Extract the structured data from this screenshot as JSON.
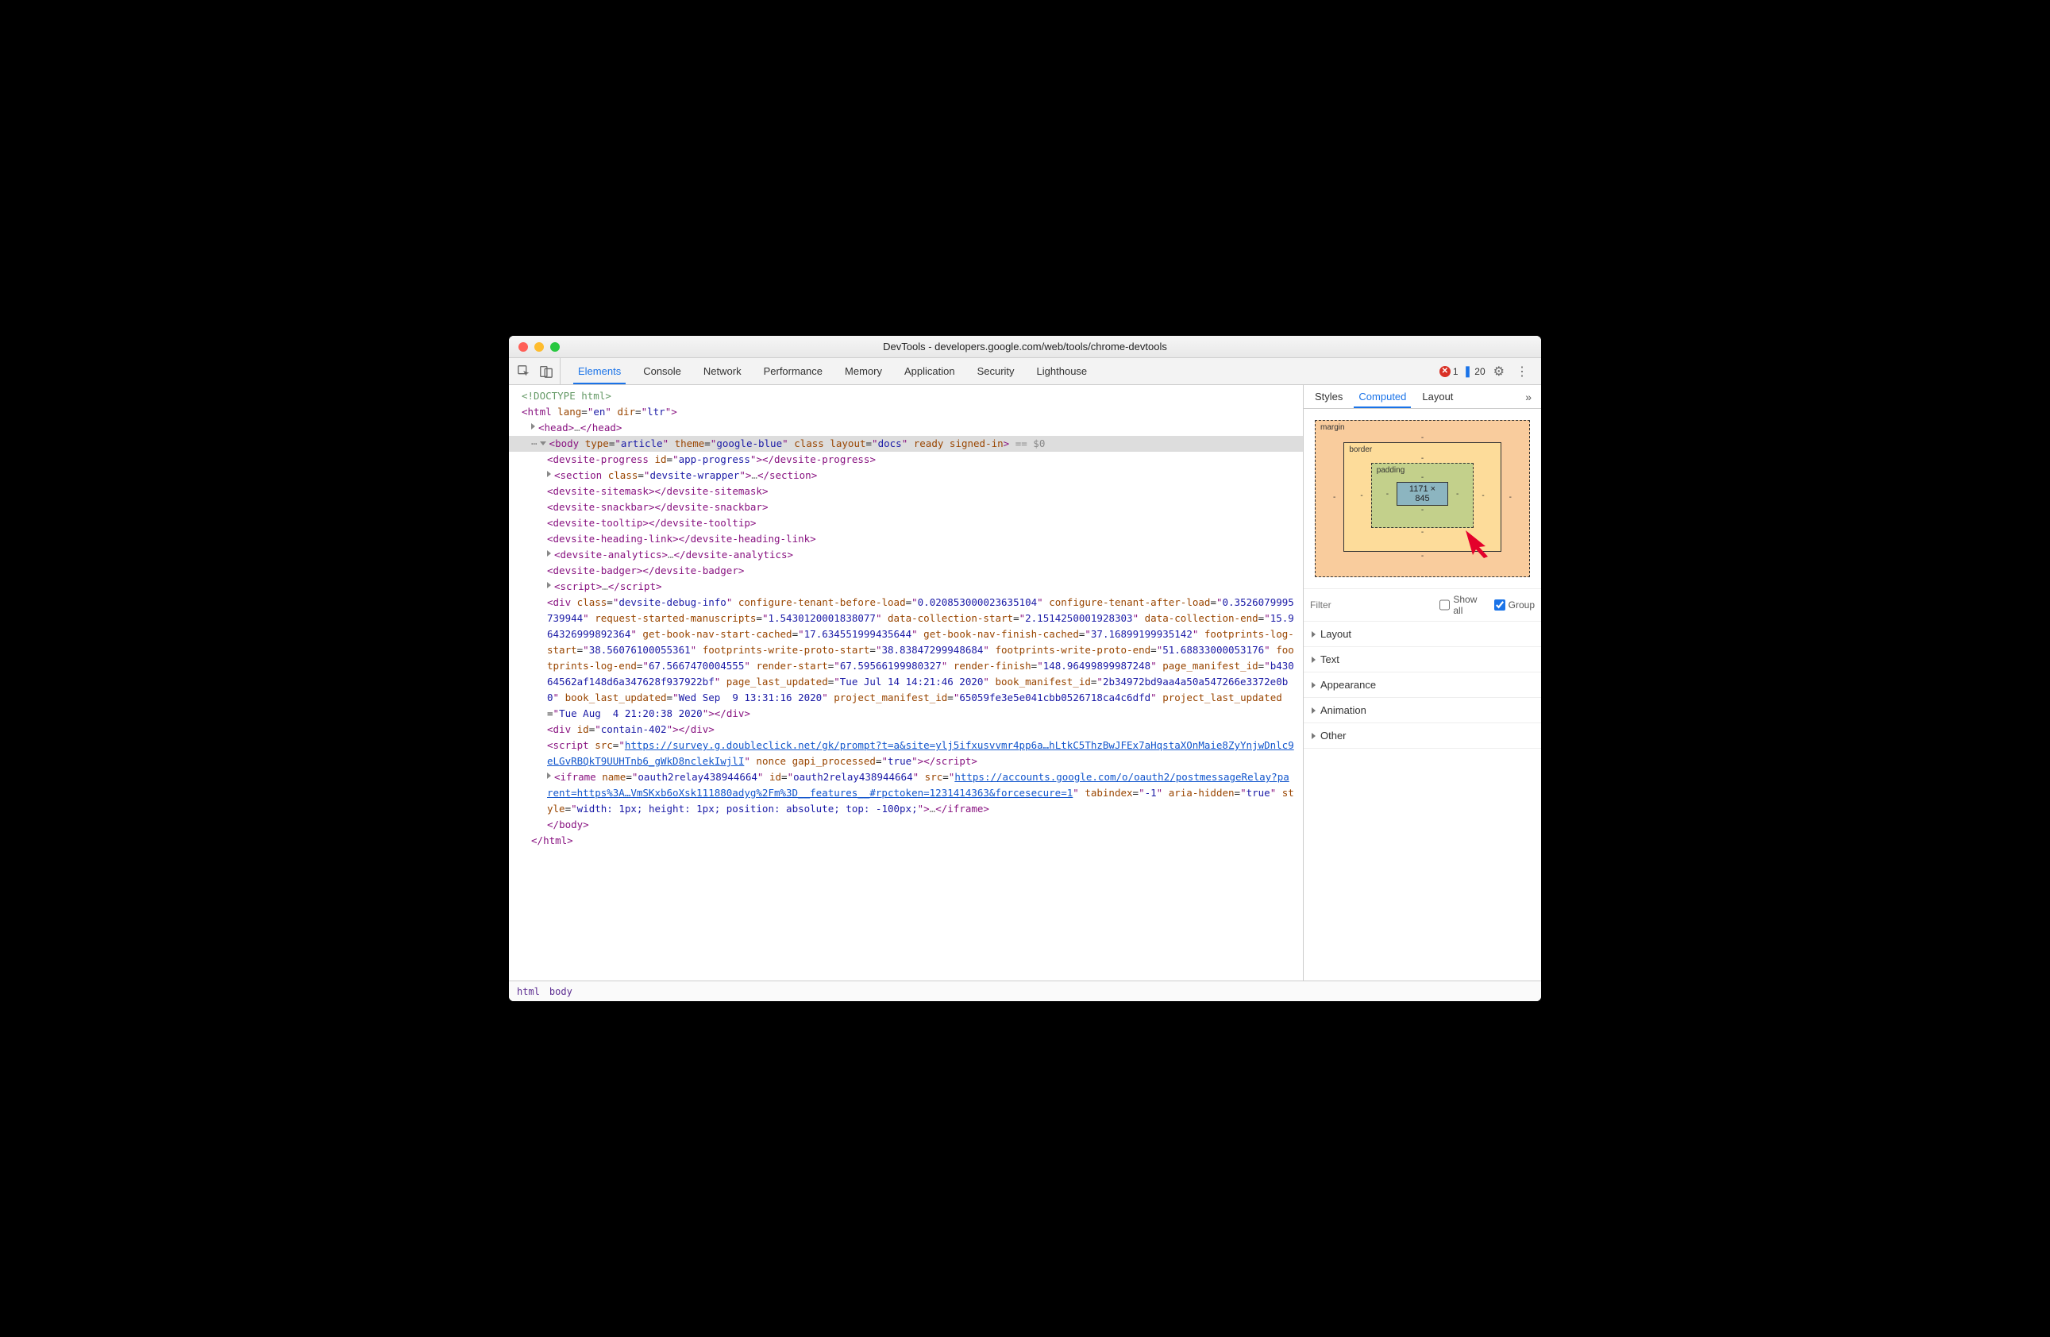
{
  "window": {
    "title": "DevTools - developers.google.com/web/tools/chrome-devtools"
  },
  "tabs": [
    "Elements",
    "Console",
    "Network",
    "Performance",
    "Memory",
    "Application",
    "Security",
    "Lighthouse"
  ],
  "activeTab": "Elements",
  "counters": {
    "errors": "1",
    "messages": "20"
  },
  "breadcrumb": [
    "html",
    "body"
  ],
  "sidebar": {
    "tabs": [
      "Styles",
      "Computed",
      "Layout"
    ],
    "active": "Computed",
    "moreGlyph": "»"
  },
  "boxmodel": {
    "margin": "margin",
    "border": "border",
    "padding": "padding",
    "dash": "-",
    "content": "1171 × 845"
  },
  "filter": {
    "placeholder": "Filter",
    "showall": "Show all",
    "group": "Group"
  },
  "groups": [
    "Layout",
    "Text",
    "Appearance",
    "Animation",
    "Other"
  ],
  "dom": {
    "doctype": "<!DOCTYPE html>",
    "html_open": "<html lang=\"en\" dir=\"ltr\">",
    "head": {
      "open": "<head>",
      "close": "</head>",
      "mid": "…"
    },
    "body_open_tag": "body",
    "body_attrs": [
      {
        "n": "type",
        "v": "article"
      },
      {
        "n": "theme",
        "v": "google-blue"
      },
      {
        "n": "class",
        "v": null
      },
      {
        "n": "layout",
        "v": "docs"
      },
      {
        "n": "ready",
        "v": null
      },
      {
        "n": "signed-in",
        "v": null
      }
    ],
    "body_suffix": " == $0",
    "children": [
      {
        "raw": "<devsite-progress id=\"app-progress\"></devsite-progress>",
        "attrs": [
          {
            "n": "id",
            "v": "app-progress"
          }
        ],
        "tag": "devsite-progress"
      },
      {
        "tag": "section",
        "attrs": [
          {
            "n": "class",
            "v": "devsite-wrapper"
          }
        ],
        "expand": true,
        "mid": "…"
      },
      {
        "tag": "devsite-sitemask",
        "selfclose": true
      },
      {
        "tag": "devsite-snackbar",
        "selfclose": true
      },
      {
        "tag": "devsite-tooltip",
        "selfclose": true
      },
      {
        "tag": "devsite-heading-link",
        "selfclose": true
      },
      {
        "tag": "devsite-analytics",
        "expand": true,
        "mid": "…"
      },
      {
        "tag": "devsite-badger",
        "selfclose": true
      },
      {
        "tag": "script",
        "expand": true,
        "mid": "…"
      }
    ],
    "bigdiv": {
      "tag": "div",
      "attrs": [
        {
          "n": "class",
          "v": "devsite-debug-info"
        },
        {
          "n": "configure-tenant-before-load",
          "v": "0.020853000023635104"
        },
        {
          "n": "configure-tenant-after-load",
          "v": "0.3526079995739944"
        },
        {
          "n": "request-started-manuscripts",
          "v": "1.5430120001838077"
        },
        {
          "n": "data-collection-start",
          "v": "2.1514250001928303"
        },
        {
          "n": "data-collection-end",
          "v": "15.964326999892364"
        },
        {
          "n": "get-book-nav-start-cached",
          "v": "17.634551999435644"
        },
        {
          "n": "get-book-nav-finish-cached",
          "v": "37.16899199935142"
        },
        {
          "n": "footprints-log-start",
          "v": "38.56076100055361"
        },
        {
          "n": "footprints-write-proto-start",
          "v": "38.83847299948684"
        },
        {
          "n": "footprints-write-proto-end",
          "v": "51.68833000053176"
        },
        {
          "n": "footprints-log-end",
          "v": "67.5667470004555"
        },
        {
          "n": "render-start",
          "v": "67.59566199980327"
        },
        {
          "n": "render-finish",
          "v": "148.96499899987248"
        },
        {
          "n": "page_manifest_id",
          "v": "b43064562af148d6a347628f937922bf"
        },
        {
          "n": "page_last_updated",
          "v": "Tue Jul 14 14:21:46 2020"
        },
        {
          "n": "book_manifest_id",
          "v": "2b34972bd9aa4a50a547266e3372e0b0"
        },
        {
          "n": "book_last_updated",
          "v": "Wed Sep  9 13:31:16 2020"
        },
        {
          "n": "project_manifest_id",
          "v": "65059fe3e5e041cbb0526718ca4c6dfd"
        },
        {
          "n": "project_last_updated",
          "v": "Tue Aug  4 21:20:38 2020"
        }
      ]
    },
    "contain": {
      "tag": "div",
      "attrs": [
        {
          "n": "id",
          "v": "contain-402"
        }
      ]
    },
    "surveyscript": {
      "tag": "script",
      "srcprefix": "https://survey.g.doubleclick.net/gk/prompt?t=a&site=ylj5ifxusvvmr4pp6a…hLtkC5ThzBwJFEx7aHqstaXOnMaie8ZyYnjwDnlc9eLGvRBQkT9UUHTnb6_gWkD8nclekIwjlI",
      "after": [
        {
          "n": "nonce",
          "v": null
        },
        {
          "n": "gapi_processed",
          "v": "true"
        }
      ]
    },
    "iframe": {
      "tag": "iframe",
      "attrs1": [
        {
          "n": "name",
          "v": "oauth2relay438944664"
        },
        {
          "n": "id",
          "v": "oauth2relay438944664"
        }
      ],
      "src": "https://accounts.google.com/o/oauth2/postmessageRelay?parent=https%3A…VmSKxb6oXsk111880adyg%2Fm%3D__features__#rpctoken=1231414363&forcesecure=1",
      "attrs2": [
        {
          "n": "tabindex",
          "v": "-1"
        },
        {
          "n": "aria-hidden",
          "v": "true"
        },
        {
          "n": "style",
          "v": "width: 1px; height: 1px; position: absolute; top: -100px;"
        }
      ],
      "mid": "…"
    },
    "body_close": "</body>",
    "html_close": "</html>"
  }
}
